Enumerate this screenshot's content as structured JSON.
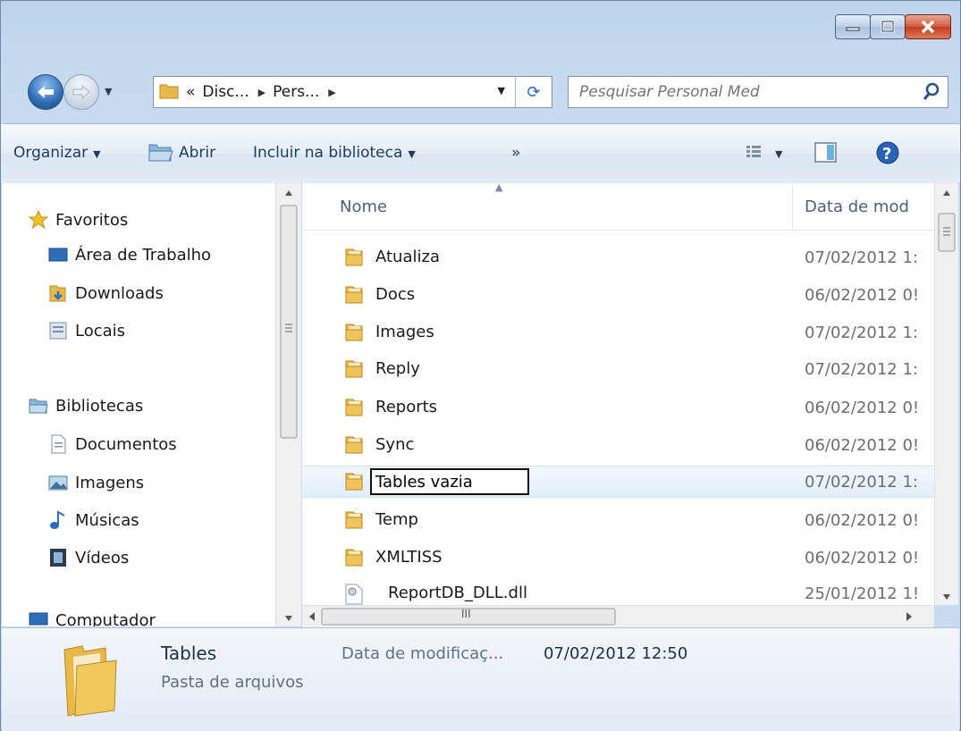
{
  "titlebar": {
    "minimize_label": "",
    "maximize_label": "",
    "close_label": ""
  },
  "address": {
    "overflow": "«",
    "segments": [
      "Disc...",
      "Pers..."
    ],
    "search_placeholder": "Pesquisar Personal Med"
  },
  "toolbar": {
    "organize": "Organizar",
    "open": "Abrir",
    "include_library": "Incluir na biblioteca",
    "more": "»"
  },
  "nav": {
    "favorites": "Favoritos",
    "desktop": "Área de Trabalho",
    "downloads": "Downloads",
    "places": "Locais",
    "libraries": "Bibliotecas",
    "documents": "Documentos",
    "images": "Imagens",
    "music": "Músicas",
    "videos": "Vídeos",
    "computer": "Computador"
  },
  "columns": {
    "name": "Nome",
    "date": "Data de mod"
  },
  "files": [
    {
      "name": "Atualiza",
      "date": "07/02/2012 1:",
      "type": "folder"
    },
    {
      "name": "Docs",
      "date": "06/02/2012 0!",
      "type": "folder"
    },
    {
      "name": "Images",
      "date": "07/02/2012 1:",
      "type": "folder"
    },
    {
      "name": "Reply",
      "date": "07/02/2012 1:",
      "type": "folder"
    },
    {
      "name": "Reports",
      "date": "06/02/2012 0!",
      "type": "folder"
    },
    {
      "name": "Sync",
      "date": "06/02/2012 0!",
      "type": "folder"
    },
    {
      "name": "Tables vazia",
      "date": "07/02/2012 1:",
      "type": "folder",
      "renaming": true
    },
    {
      "name": "Temp",
      "date": "06/02/2012 0!",
      "type": "folder"
    },
    {
      "name": "XMLTISS",
      "date": "06/02/2012 0!",
      "type": "folder"
    },
    {
      "name": "ReportDB_DLL.dll",
      "date": "25/01/2012 1!",
      "type": "dll"
    }
  ],
  "hscroll_thumb_label": "III",
  "details": {
    "name": "Tables",
    "type": "Pasta de arquivos",
    "modified_label": "Data de modificaç...",
    "modified_value": "07/02/2012 12:50"
  },
  "colors": {
    "folder": "#e8b84a",
    "accent": "#1e3a5f",
    "selection": "#e2eefb",
    "close": "#c53a1c"
  }
}
